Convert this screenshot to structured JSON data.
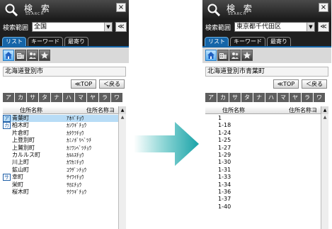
{
  "colors": {
    "accent": "#1565a8",
    "arrow": "#2ab0b0"
  },
  "left": {
    "title": "検 索",
    "subtitle": "SEARCH",
    "close": "×",
    "range_label": "検索範囲",
    "range_value": "全国",
    "collapse": "≪",
    "tabs": [
      "リスト",
      "キーワード",
      "最寄り"
    ],
    "icons": [
      "house-icon",
      "building-icon",
      "people-icon",
      "star-icon"
    ],
    "address": "北海道登別市",
    "top_btn": "≪TOP",
    "back_btn": "＜戻る",
    "kana": [
      "ア",
      "カ",
      "サ",
      "タ",
      "ナ",
      "ハ",
      "マ",
      "ヤ",
      "ラ",
      "ワ"
    ],
    "col_name": "住所名称",
    "col_kana": "住所名称ヨ",
    "rows": [
      {
        "ini": "ア",
        "name": "青葉町",
        "kana": "ｱｵﾊﾞﾁｮｳ"
      },
      {
        "ini": "カ",
        "name": "柏木町",
        "kana": "ｶｼﾜｷﾞﾁｮｳ"
      },
      {
        "ini": "",
        "name": "片倉町",
        "kana": "ｶﾀｸﾗﾁｮｳ"
      },
      {
        "ini": "",
        "name": "上登別町",
        "kana": "ｶﾐﾉﾎﾞﾘﾍﾞﾂﾁ"
      },
      {
        "ini": "",
        "name": "上鷲別町",
        "kana": "ｶﾐﾜｼﾍﾞﾂﾁｮｳ"
      },
      {
        "ini": "",
        "name": "カルルス町",
        "kana": "ｶﾙﾙｽﾁｮｳ"
      },
      {
        "ini": "",
        "name": "川上町",
        "kana": "ｶﾜｶﾐﾁｮｳ"
      },
      {
        "ini": "",
        "name": "鉱山町",
        "kana": "ｺｳｻﾞﾝﾁｮｳ"
      },
      {
        "ini": "サ",
        "name": "幸町",
        "kana": "ｻｲﾜｲﾁｮｳ"
      },
      {
        "ini": "",
        "name": "栄町",
        "kana": "ｻｶｴﾁｮｳ"
      },
      {
        "ini": "",
        "name": "桜木町",
        "kana": "ｻｸﾗｷﾞﾁｮｳ"
      }
    ]
  },
  "right": {
    "title": "検 索",
    "subtitle": "SEARCH",
    "close": "×",
    "range_label": "検索範囲",
    "range_value": "東京都千代田区",
    "collapse": "≪",
    "tabs": [
      "リスト",
      "キーワード",
      "最寄り"
    ],
    "icons": [
      "house-icon",
      "building-icon",
      "people-icon",
      "star-icon"
    ],
    "address": "北海道登別市青葉町",
    "top_btn": "≪TOP",
    "back_btn": "＜戻る",
    "kana": [
      "ア",
      "カ",
      "サ",
      "タ",
      "ナ",
      "ハ",
      "マ",
      "ヤ",
      "ラ",
      "ワ"
    ],
    "col_name": "住所名称",
    "col_kana": "住所名称ヨ",
    "rows": [
      {
        "ini": "",
        "name": "1",
        "kana": ""
      },
      {
        "ini": "",
        "name": "1-18",
        "kana": ""
      },
      {
        "ini": "",
        "name": "1-24",
        "kana": ""
      },
      {
        "ini": "",
        "name": "1-25",
        "kana": ""
      },
      {
        "ini": "",
        "name": "1-27",
        "kana": ""
      },
      {
        "ini": "",
        "name": "1-29",
        "kana": ""
      },
      {
        "ini": "",
        "name": "1-30",
        "kana": ""
      },
      {
        "ini": "",
        "name": "1-31",
        "kana": ""
      },
      {
        "ini": "",
        "name": "1-33",
        "kana": ""
      },
      {
        "ini": "",
        "name": "1-34",
        "kana": ""
      },
      {
        "ini": "",
        "name": "1-36",
        "kana": ""
      },
      {
        "ini": "",
        "name": "1-37",
        "kana": ""
      },
      {
        "ini": "",
        "name": "1-40",
        "kana": ""
      }
    ]
  }
}
